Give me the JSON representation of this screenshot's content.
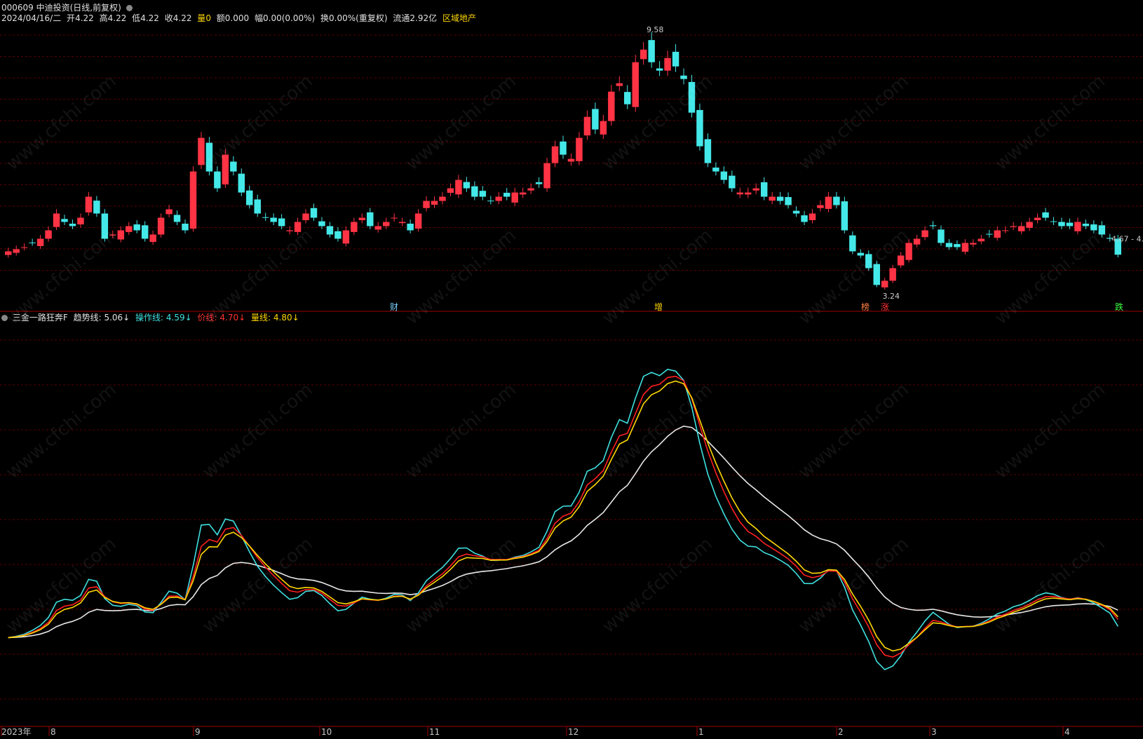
{
  "header": {
    "code_name": "000609 中迪投资(日线,前复权)",
    "date": "2024/04/16/二",
    "open_label": "开",
    "open": "4.22",
    "high_label": "高",
    "high": "4.22",
    "low_label": "低",
    "low": "4.22",
    "close_label": "收",
    "close": "4.22",
    "vol_label": "量",
    "vol": "0",
    "amt_label": "额",
    "amt": "0.000",
    "chg_label": "幅",
    "chg": "0.00(0.00%)",
    "turn_label": "换",
    "turn": "0.00%(重复权)",
    "float_label": "流通",
    "float": "2.92亿",
    "sector": "区域地产"
  },
  "indicator": {
    "name": "三金一路狂奔F",
    "trend_label": "趋势线:",
    "trend": "5.06↓",
    "op_label": "操作线:",
    "op": "4.59↓",
    "price_label": "价线:",
    "price": "4.70↓",
    "vol_label": "量线:",
    "vol": "4.80↓"
  },
  "annotations": {
    "high_label": "9.58",
    "low_label": "3.24",
    "last_label": "4.67 - 4.",
    "marks": [
      "财",
      "增",
      "榜",
      "涨",
      "跌"
    ]
  },
  "time_axis": [
    "2023年",
    "8",
    "9",
    "10",
    "11",
    "12",
    "1",
    "2",
    "3",
    "4"
  ],
  "watermark": "www.cfchi.com",
  "colors": {
    "up": "#ff3344",
    "down": "#44e8e8",
    "trend": "#e8e8e8",
    "op": "#3fe0e0",
    "price": "#ff2020",
    "vol": "#ffd700",
    "grid": "#5a0000"
  },
  "chart_data": {
    "type": "candlestick",
    "price_range": [
      3.24,
      9.58
    ],
    "candles_close": [
      4.3,
      4.35,
      4.4,
      4.5,
      4.6,
      4.8,
      5.2,
      5.0,
      4.9,
      5.1,
      5.6,
      5.2,
      4.6,
      4.7,
      4.8,
      4.9,
      4.8,
      4.6,
      4.7,
      5.1,
      5.3,
      5.0,
      4.8,
      6.2,
      7.0,
      6.2,
      5.8,
      6.6,
      6.2,
      5.7,
      5.4,
      5.2,
      5.1,
      5.0,
      4.9,
      4.8,
      5.0,
      5.2,
      5.1,
      4.9,
      4.7,
      4.6,
      4.8,
      5.0,
      5.1,
      4.9,
      4.9,
      5.0,
      5.1,
      5.0,
      4.8,
      5.2,
      5.5,
      5.5,
      5.6,
      5.8,
      6.0,
      5.8,
      5.6,
      5.6,
      5.5,
      5.6,
      5.6,
      5.7,
      5.7,
      5.8,
      5.9,
      6.4,
      6.8,
      6.6,
      6.5,
      7.0,
      7.5,
      7.2,
      7.4,
      8.1,
      8.3,
      7.8,
      8.8,
      9.1,
      8.8,
      8.6,
      8.9,
      8.7,
      8.4,
      7.6,
      6.8,
      6.4,
      6.2,
      6.0,
      5.8,
      5.7,
      5.7,
      5.8,
      5.6,
      5.6,
      5.5,
      5.4,
      5.2,
      5.0,
      5.2,
      5.4,
      5.6,
      5.4,
      4.8,
      4.3,
      4.2,
      3.9,
      3.5,
      3.6,
      3.9,
      4.2,
      4.5,
      4.6,
      4.8,
      4.9,
      4.5,
      4.4,
      4.4,
      4.5,
      4.5,
      4.6,
      4.7,
      4.8,
      4.8,
      4.9,
      4.9,
      5.0,
      5.1,
      5.1,
      5.0,
      4.9,
      4.9,
      5.0,
      4.9,
      4.8,
      4.7,
      4.6,
      4.22
    ],
    "lines": {
      "trend": "white smoothed line",
      "op": "cyan line",
      "price": "red line",
      "vol": "yellow line"
    },
    "xlabel": "",
    "ylabel": ""
  }
}
